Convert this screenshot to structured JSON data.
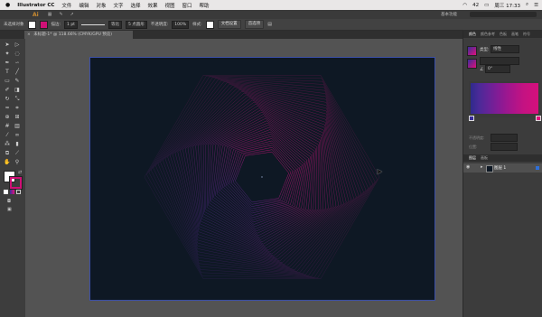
{
  "menubar": {
    "app_name": "Illustrator CC",
    "items": [
      "文件",
      "编辑",
      "对象",
      "文字",
      "选择",
      "效果",
      "视图",
      "窗口",
      "帮助"
    ],
    "battery": "42",
    "clock": "周三 17:33"
  },
  "app_toolbar": {
    "ai_logo": "Ai",
    "workspace": "基本功能"
  },
  "control_bar": {
    "selection_label": "未选择对象",
    "stroke_label": "描边:",
    "stroke_weight": "1 pt",
    "stroke_profile": "等比",
    "brush": "5 点圆形",
    "opacity_label": "不透明度:",
    "opacity_value": "100%",
    "style_label": "样式:",
    "doc_setup_button": "文档设置",
    "preferences_button": "首选项"
  },
  "document_tab": {
    "title": "未标题-1* @ 118.66% (CMYK/GPU 预览)",
    "close_symbol": "×"
  },
  "right_panels": {
    "top_tabs": [
      "颜色",
      "颜色参考",
      "色板",
      "画笔",
      "符号"
    ],
    "type_label": "类型:",
    "type_value": "线性",
    "angle_value": "0°",
    "opacity_label": "不透明度:",
    "position_label": "位置:",
    "layers_tabs": [
      "图层",
      "画板"
    ],
    "layer_name": "图层 1"
  },
  "colors": {
    "artboard_bg": "#0e1824",
    "gradient_start": "#3a2d99",
    "gradient_end": "#e0107c",
    "accent_pink": "#d01076",
    "selection_blue": "#2e6fd8"
  }
}
